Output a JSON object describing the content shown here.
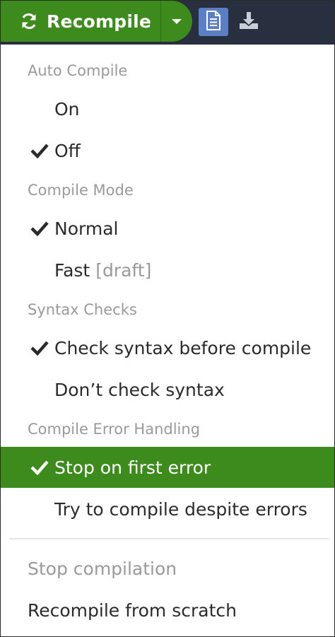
{
  "toolbar": {
    "recompile_label": "Recompile",
    "icons": {
      "recompile": "refresh-icon",
      "caret": "caret-down-icon",
      "logs": "document-icon",
      "download": "download-icon"
    }
  },
  "menu": {
    "auto_compile": {
      "header": "Auto Compile",
      "on": "On",
      "off": "Off",
      "selected": "Off"
    },
    "compile_mode": {
      "header": "Compile Mode",
      "normal": "Normal",
      "fast": "Fast",
      "fast_suffix": "[draft]",
      "selected": "Normal"
    },
    "syntax_checks": {
      "header": "Syntax Checks",
      "check": "Check syntax before compile",
      "dont": "Don’t check syntax",
      "selected": "Check syntax before compile"
    },
    "error_handling": {
      "header": "Compile Error Handling",
      "stop": "Stop on first error",
      "try": "Try to compile despite errors",
      "selected": "Stop on first error"
    },
    "actions": {
      "stop_compilation": "Stop compilation",
      "recompile_scratch": "Recompile from scratch"
    }
  },
  "colors": {
    "accent": "#3d8b1d",
    "toolbar_bg": "#283040",
    "muted": "#9a9a9a",
    "text": "#2b2b2b",
    "doc_button": "#5b7ec4"
  }
}
